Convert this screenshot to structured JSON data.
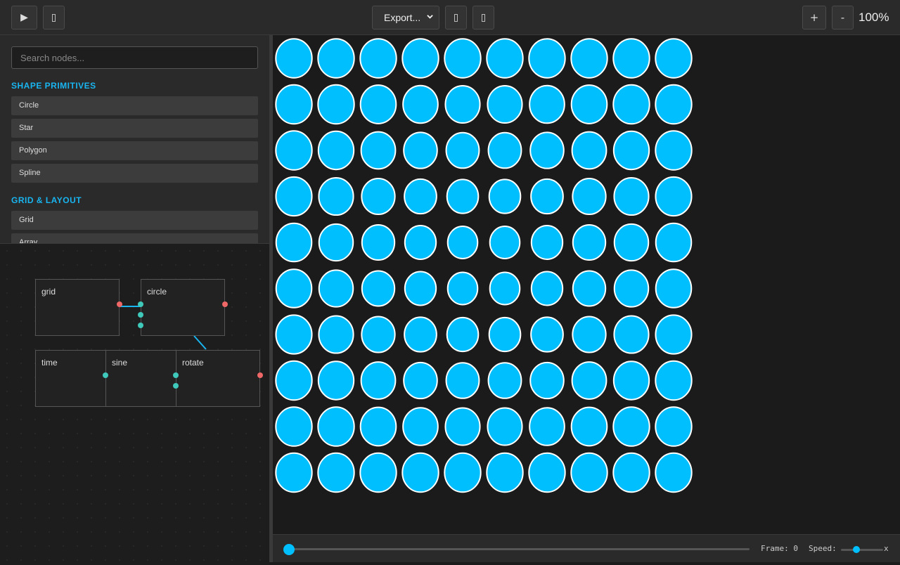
{
  "toolbar": {
    "play_label": "▶",
    "export_label": "Export...",
    "zoom_in_label": "+",
    "zoom_out_label": "-",
    "zoom_level": "100%"
  },
  "sidebar": {
    "search_placeholder": "Search nodes...",
    "sections": [
      {
        "title": "SHAPE PRIMITIVES",
        "items": [
          "Circle",
          "Star",
          "Polygon",
          "Spline"
        ]
      },
      {
        "title": "GRID & LAYOUT",
        "items": [
          "Grid",
          "Array"
        ]
      }
    ]
  },
  "node_graph": {
    "nodes": [
      {
        "id": "grid",
        "title": "grid"
      },
      {
        "id": "circle",
        "title": "circle"
      },
      {
        "id": "time",
        "title": "time"
      },
      {
        "id": "sine",
        "title": "sine"
      },
      {
        "id": "rotate",
        "title": "rotate"
      }
    ]
  },
  "canvas": {
    "grid_rows": 10,
    "grid_cols": 10,
    "circle_fill": "#00bfff",
    "circle_stroke": "#ffffff"
  },
  "timeline": {
    "frame_label": "Frame: 0",
    "speed_label": "Speed:",
    "speed_unit": "x",
    "progress": 0
  },
  "colors": {
    "accent": "#19b5f0",
    "port_in": "#3fc9bb",
    "port_out": "#ef6767",
    "wire": "#19b5f0"
  }
}
